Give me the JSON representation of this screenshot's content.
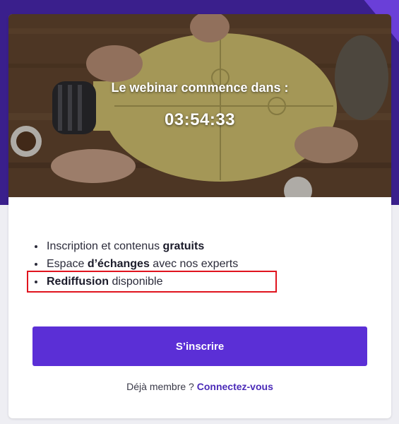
{
  "hero": {
    "title": "Le webinar commence dans :",
    "countdown": "03:54:33"
  },
  "features": {
    "item1": {
      "prefix": "Inscription et contenus ",
      "bold": "gratuits",
      "suffix": ""
    },
    "item2": {
      "prefix": "Espace ",
      "bold": "d’échanges",
      "suffix": " avec nos experts"
    },
    "item3": {
      "prefix": "",
      "bold": "Rediffusion",
      "suffix": " disponible"
    }
  },
  "cta": {
    "signup_label": "S’inscrire",
    "member_text": "Déjà membre ? ",
    "login_link": "Connectez-vous"
  },
  "colors": {
    "button": "#5b2fd6",
    "link": "#4b2bb8",
    "highlight": "#e0141e",
    "header_bg": "#3a1f8c"
  }
}
